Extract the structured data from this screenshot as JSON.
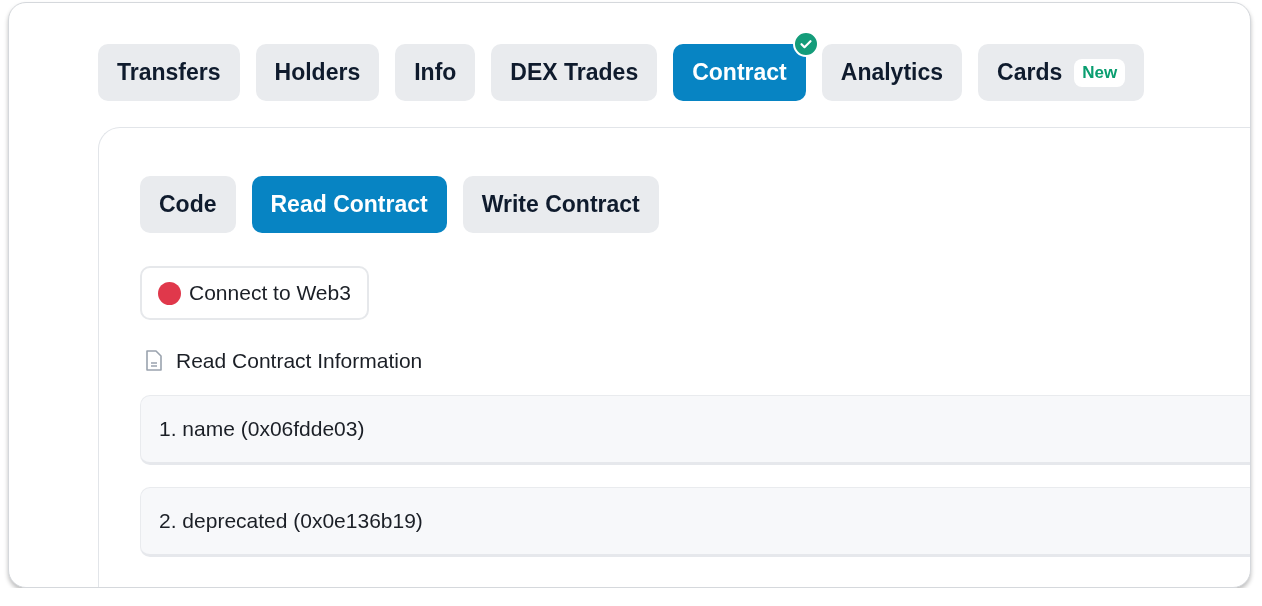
{
  "tabs": [
    {
      "label": "Transfers",
      "selected": false,
      "checked": false
    },
    {
      "label": "Holders",
      "selected": false,
      "checked": false
    },
    {
      "label": "Info",
      "selected": false,
      "checked": false
    },
    {
      "label": "DEX Trades",
      "selected": false,
      "checked": false
    },
    {
      "label": "Contract",
      "selected": true,
      "checked": true
    },
    {
      "label": "Analytics",
      "selected": false,
      "checked": false
    },
    {
      "label": "Cards",
      "selected": false,
      "checked": false,
      "badge": "New"
    }
  ],
  "subtabs": [
    {
      "label": "Code",
      "selected": false
    },
    {
      "label": "Read Contract",
      "selected": true
    },
    {
      "label": "Write Contract",
      "selected": false
    }
  ],
  "connect_button": {
    "label": "Connect to Web3",
    "color": "#e0384b"
  },
  "section_title": "Read Contract Information",
  "functions": [
    {
      "label": "1. name (0x06fdde03)"
    },
    {
      "label": "2. deprecated (0x0e136b19)"
    }
  ]
}
